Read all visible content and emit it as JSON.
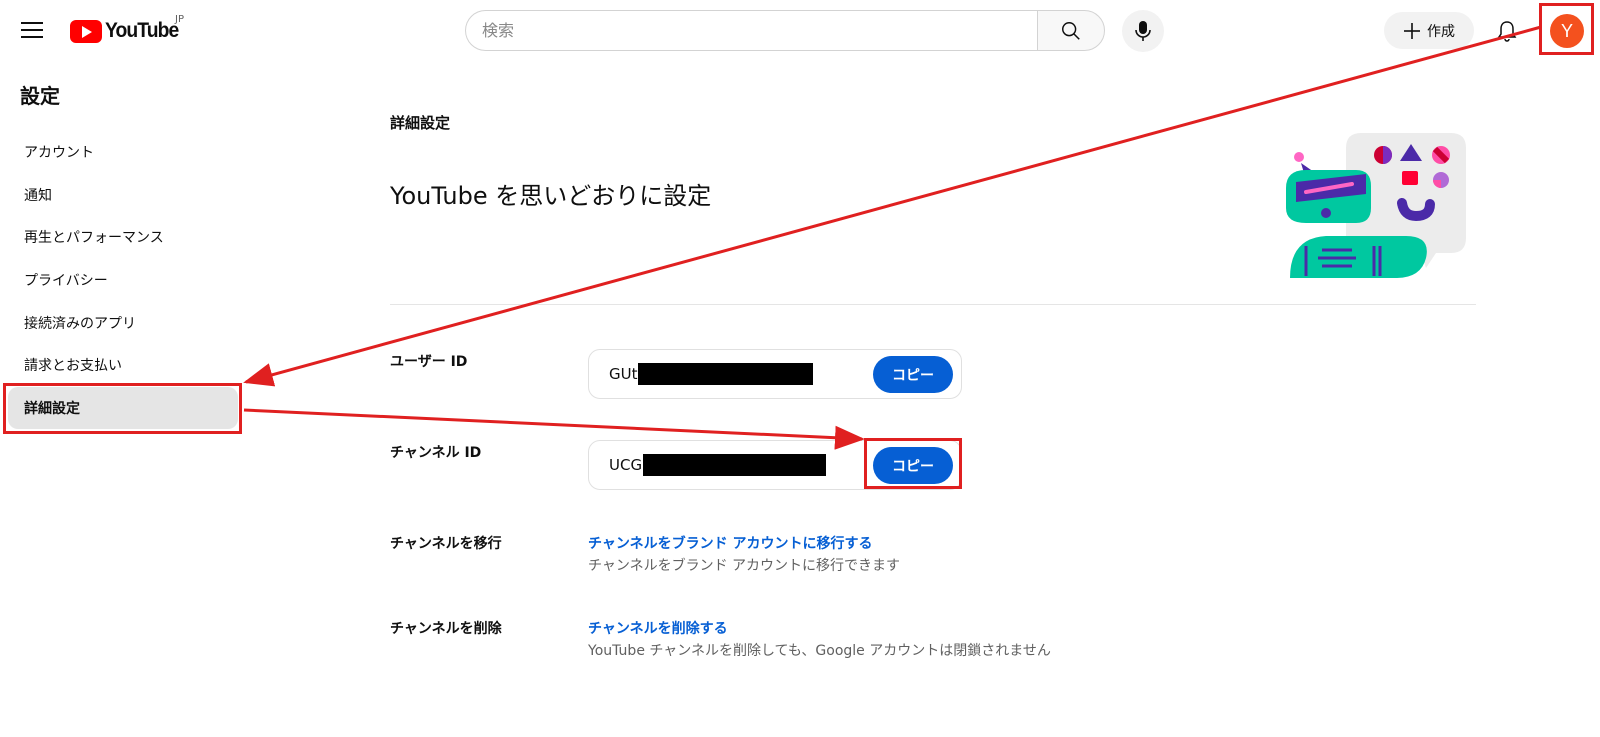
{
  "header": {
    "logo_text": "YouTube",
    "region": "JP",
    "search_placeholder": "検索",
    "create_label": "作成",
    "avatar_letter": "Y"
  },
  "sidebar": {
    "title": "設定",
    "items": [
      {
        "label": "アカウント"
      },
      {
        "label": "通知"
      },
      {
        "label": "再生とパフォーマンス"
      },
      {
        "label": "プライバシー"
      },
      {
        "label": "接続済みのアプリ"
      },
      {
        "label": "請求とお支払い"
      },
      {
        "label": "詳細設定",
        "active": true
      }
    ]
  },
  "main": {
    "heading": "詳細設定",
    "title": "YouTube を思いどおりに設定",
    "user_id": {
      "label": "ユーザー ID",
      "value_prefix": "GUt",
      "copy_label": "コピー"
    },
    "channel_id": {
      "label": "チャンネル ID",
      "value_prefix": "UCG",
      "copy_label": "コピー"
    },
    "migrate": {
      "label": "チャンネルを移行",
      "link": "チャンネルをブランド アカウントに移行する",
      "desc": "チャンネルをブランド アカウントに移行できます"
    },
    "delete": {
      "label": "チャンネルを削除",
      "link": "チャンネルを削除する",
      "desc": "YouTube チャンネルを削除しても、Google アカウントは閉鎖されません"
    }
  },
  "colors": {
    "accent_blue": "#065fd4",
    "youtube_red": "#ff0000",
    "avatar_orange": "#f4511e",
    "annotation_red": "#e02020"
  }
}
